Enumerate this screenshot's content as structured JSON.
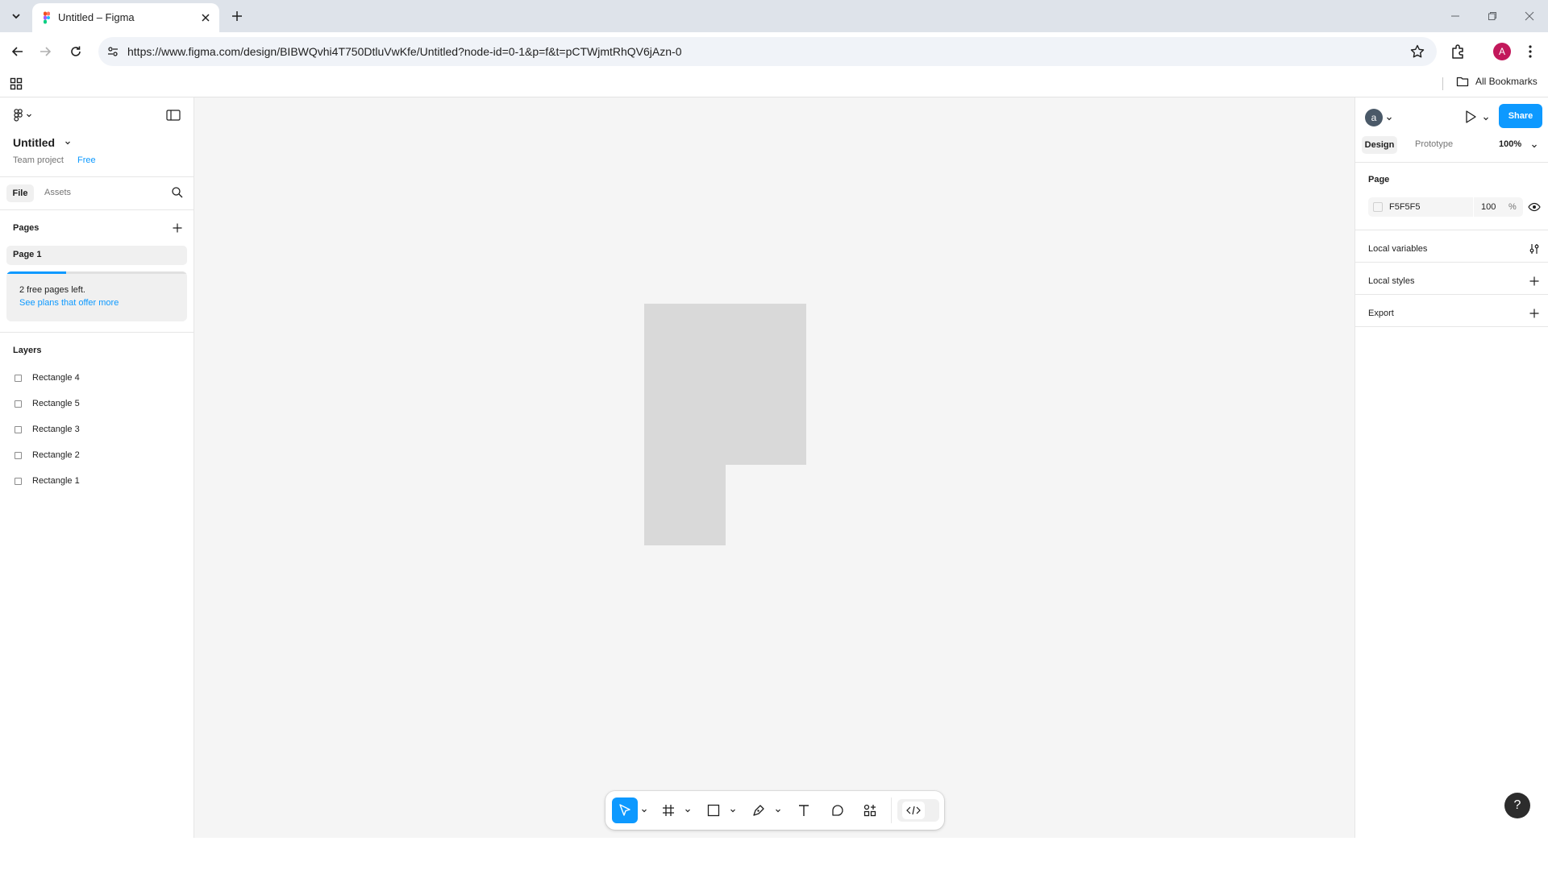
{
  "browser": {
    "tab_title": "Untitled – Figma",
    "url_prefix": "https://",
    "url_host": "www.figma.com",
    "url_path": "/design/BIBWQvhi4T750DtluVwKfe/Untitled?node-id=0-1&p=f&t=pCTWjmtRhQV6jAzn-0",
    "profile_initial": "A",
    "all_bookmarks": "All Bookmarks"
  },
  "left_panel": {
    "file_name": "Untitled",
    "project": "Team project",
    "plan_badge": "Free",
    "tabs": [
      "File",
      "Assets"
    ],
    "pages_heading": "Pages",
    "pages": [
      "Page 1"
    ],
    "notice_text": "2 free pages left.",
    "notice_link": "See plans that offer more",
    "notice_progress": 0.33,
    "layers_heading": "Layers",
    "layers": [
      "Rectangle 4",
      "Rectangle 5",
      "Rectangle 3",
      "Rectangle 2",
      "Rectangle 1"
    ]
  },
  "right_panel": {
    "user_initial": "a",
    "share_label": "Share",
    "tabs": [
      "Design",
      "Prototype"
    ],
    "zoom": "100%",
    "page_heading": "Page",
    "page_color_hex": "F5F5F5",
    "page_opacity": "100",
    "percent_sign": "%",
    "sections": [
      "Local variables",
      "Local styles",
      "Export"
    ]
  },
  "toolbar_tools": [
    "move",
    "frame",
    "rectangle",
    "pen",
    "text",
    "comment",
    "actions",
    "dev-mode"
  ],
  "help_label": "?",
  "colors": {
    "accent": "#0d99ff",
    "canvas": "#f5f5f5",
    "shape_fill": "#d9d9d9",
    "avatar_profile": "#c2185b"
  }
}
